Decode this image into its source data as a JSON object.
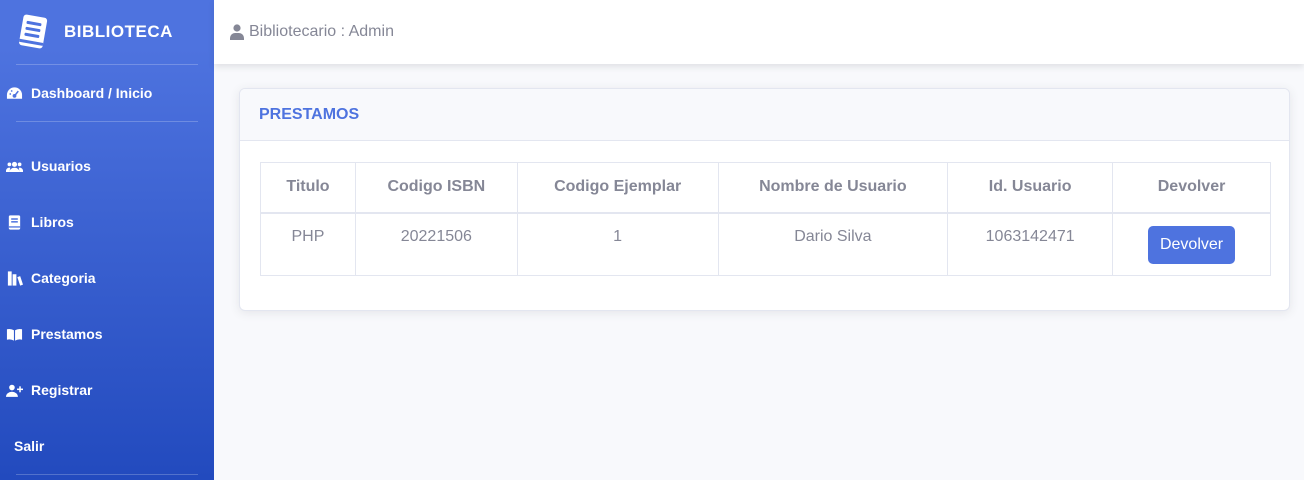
{
  "sidebar": {
    "brand": "BIBLIOTECA",
    "items": [
      {
        "label": "Dashboard / Inicio",
        "icon": "tachometer-icon"
      },
      {
        "label": "Usuarios",
        "icon": "users-icon"
      },
      {
        "label": "Libros",
        "icon": "book-icon"
      },
      {
        "label": "Categoria",
        "icon": "category-icon"
      },
      {
        "label": "Prestamos",
        "icon": "book-open-icon"
      },
      {
        "label": "Registrar",
        "icon": "user-plus-icon"
      },
      {
        "label": "Salir"
      }
    ]
  },
  "topbar": {
    "user_label": "Bibliotecario : Admin"
  },
  "card": {
    "title": "PRESTAMOS",
    "table": {
      "headers": [
        "Titulo",
        "Codigo ISBN",
        "Codigo Ejemplar",
        "Nombre de Usuario",
        "Id. Usuario",
        "Devolver"
      ],
      "rows": [
        {
          "titulo": "PHP",
          "isbn": "20221506",
          "ejemplar": "1",
          "nombre": "Dario Silva",
          "id_usuario": "1063142471",
          "action": "Devolver"
        }
      ]
    }
  },
  "colors": {
    "primary": "#4e73df",
    "sidebar_dark": "#224abe",
    "text_muted": "#858796"
  }
}
